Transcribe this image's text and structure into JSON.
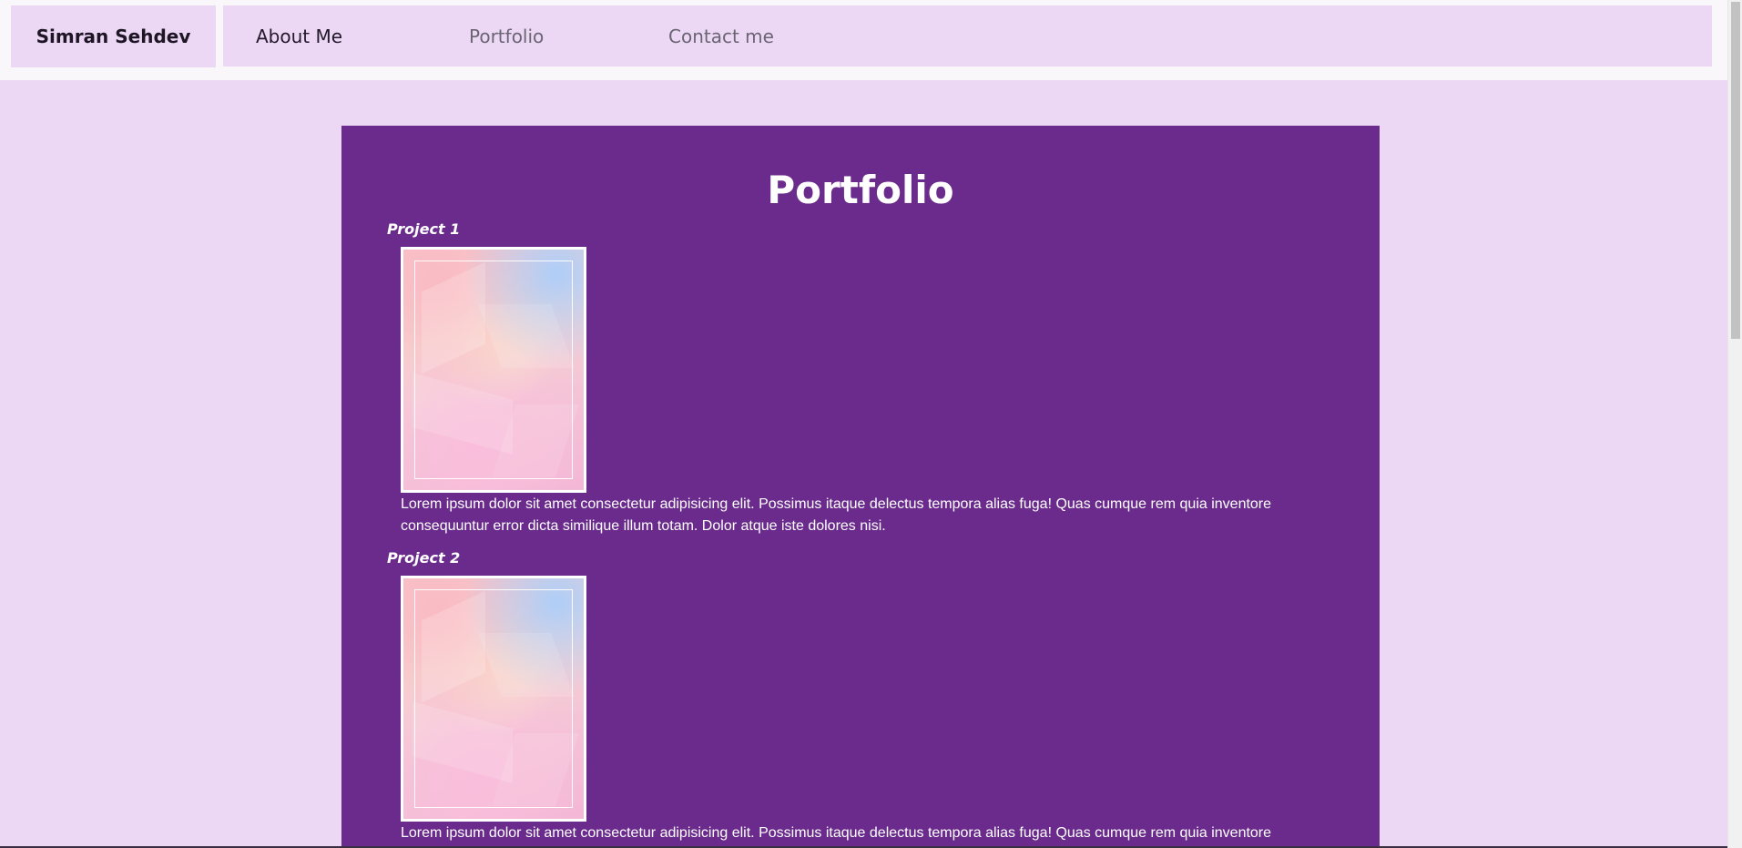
{
  "nav": {
    "brand": "Simran Sehdev",
    "links": [
      {
        "label": "About Me"
      },
      {
        "label": "Portfolio"
      },
      {
        "label": "Contact me"
      }
    ]
  },
  "main": {
    "title": "Portfolio",
    "projects": [
      {
        "title": "Project 1",
        "description": "Lorem ipsum dolor sit amet consectetur adipisicing elit. Possimus itaque delectus tempora alias fuga! Quas cumque rem quia inventore consequuntur error dicta similique illum totam. Dolor atque iste dolores nisi."
      },
      {
        "title": "Project 2",
        "description": "Lorem ipsum dolor sit amet consectetur adipisicing elit. Possimus itaque delectus tempora alias fuga! Quas cumque rem quia inventore"
      }
    ]
  },
  "colors": {
    "page_background": "#ecd8f5",
    "panel_background": "#6a2b8c",
    "nav_active_text": "#24182b",
    "nav_muted_text": "#6b6472"
  }
}
